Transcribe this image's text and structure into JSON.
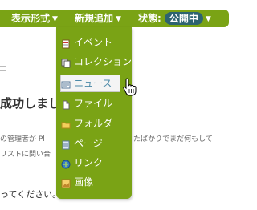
{
  "toolbar": {
    "display_format": "表示形式",
    "new_add": "新規追加",
    "status_label": "状態:",
    "status_value": "公開中"
  },
  "dropdown": {
    "items": [
      {
        "label": "イベント",
        "icon": "event-icon"
      },
      {
        "label": "コレクション",
        "icon": "collection-icon"
      },
      {
        "label": "ニュース",
        "icon": "news-icon",
        "selected": true
      },
      {
        "label": "ファイル",
        "icon": "file-icon"
      },
      {
        "label": "フォルダ",
        "icon": "folder-icon"
      },
      {
        "label": "ページ",
        "icon": "page-icon"
      },
      {
        "label": "リンク",
        "icon": "link-icon"
      },
      {
        "label": "画像",
        "icon": "image-icon"
      }
    ]
  },
  "background": {
    "heading_partial": "成功しまし",
    "text_line1_left": "の管理者が Pl",
    "text_line1_right": "たばかりでまだ何もして",
    "text_line2": "リストに問い合",
    "bottom_line": "ってください。"
  },
  "colors": {
    "accent_green": "#7aa315",
    "status_pill": "#2d6370",
    "selected_text": "#4c8aa8"
  }
}
